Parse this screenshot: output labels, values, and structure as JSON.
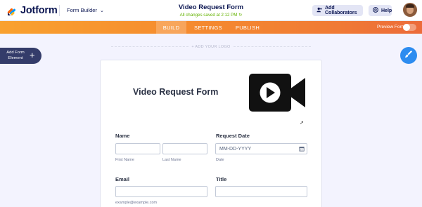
{
  "header": {
    "brand": "Jotform",
    "builder_menu": "Form Builder",
    "form_title": "Video Request Form",
    "save_status": "All changes saved at 2:12 PM",
    "add_collaborators": "Add Collaborators",
    "help": "Help"
  },
  "nav": {
    "tabs": [
      {
        "label": "BUILD",
        "active": true
      },
      {
        "label": "SETTINGS",
        "active": false
      },
      {
        "label": "PUBLISH",
        "active": false
      }
    ],
    "preview_label": "Preview Form"
  },
  "canvas": {
    "add_logo": "+ ADD YOUR LOGO",
    "add_element_line1": "Add Form",
    "add_element_line2": "Element"
  },
  "form": {
    "title": "Video Request Form",
    "name_label": "Name",
    "first_name": "First Name",
    "last_name": "Last Name",
    "request_date_label": "Request Date",
    "date_placeholder": "MM-DD-YYYY",
    "date_sublabel": "Date",
    "email_label": "Email",
    "email_sublabel": "example@example.com",
    "title_label": "Title"
  },
  "colors": {
    "nav_gradient_start": "#f9a12f",
    "nav_gradient_end": "#ec6b3a",
    "brand_navy": "#0a1551",
    "saved_green": "#64b200",
    "paint_blue": "#2d8cf0"
  },
  "icons": [
    "jotform-logo-icon",
    "chevron-down-icon",
    "add-user-icon",
    "help-icon",
    "paint-brush-icon",
    "video-camera-icon",
    "calendar-icon",
    "plus-icon"
  ]
}
